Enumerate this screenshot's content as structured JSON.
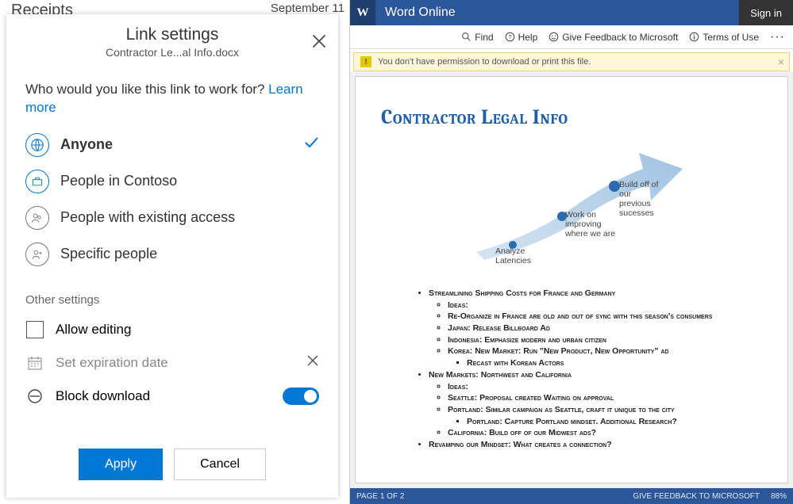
{
  "left": {
    "bg_header": "Receipts",
    "bg_date": "September 11",
    "dialog": {
      "title": "Link settings",
      "subtitle": "Contractor Le...al Info.docx",
      "prompt_text": "Who would you like this link to work for? ",
      "learn_more": "Learn more",
      "options": [
        {
          "label": "Anyone",
          "selected": true
        },
        {
          "label": "People in Contoso",
          "selected": false
        },
        {
          "label": "People with existing access",
          "selected": false
        },
        {
          "label": "Specific people",
          "selected": false
        }
      ],
      "other_header": "Other settings",
      "allow_editing": "Allow editing",
      "set_expiration": "Set expiration date",
      "block_download": "Block download",
      "apply": "Apply",
      "cancel": "Cancel"
    }
  },
  "right": {
    "app": "Word Online",
    "word_glyph": "W",
    "sign_in": "Sign in",
    "cmds": {
      "find": "Find",
      "help": "Help",
      "feedback": "Give Feedback to Microsoft",
      "terms": "Terms of Use"
    },
    "perm_msg": "You don't have permission to download or print this file.",
    "doc_title": "Contractor Legal Info",
    "arrow_nodes": {
      "a": "Analyze Latencies",
      "b": "Work on improving where we are",
      "c": "Build off of our previous sucesses"
    },
    "bullets": {
      "l1a": "Streamlining Shipping Costs for France and Germany",
      "l2a": "Ideas:",
      "l2b": "Re-Organize in France are old and out of sync with this season's consumers",
      "l2c": "Japan: Release  Billboard Ad",
      "l2d": "Indonesia: Emphasize modern and urban citizen",
      "l2e": "Korea: New Market:  Run \"New Product, New Opportunity\" ad",
      "l3a": "Recast with Korean Actors",
      "l1b": "New Markets: Northwest and California",
      "l2f": "Ideas:",
      "l2g": "Seattle: Proposal created Waiting on approval",
      "l2h": "Portland: Similar campaign as Seattle, craft it unique to the city",
      "l3b": "Portland: Capture Portland mindset.  Additional Research?",
      "l2i": "California:  Build off of our Midwest ads?",
      "l1c": "Revamping our Mindset:  What creates a connection?"
    },
    "status": {
      "page": "PAGE 1 OF 2",
      "feedback": "GIVE FEEDBACK TO MICROSOFT",
      "zoom": "88%"
    }
  }
}
